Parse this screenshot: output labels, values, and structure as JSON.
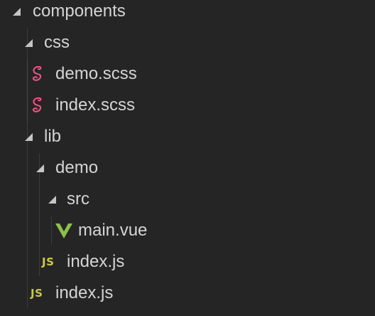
{
  "explorer": {
    "items": [
      {
        "label": "components",
        "kind": "folder",
        "expanded": true
      },
      {
        "label": "css",
        "kind": "folder",
        "expanded": true
      },
      {
        "label": "demo.scss",
        "kind": "file",
        "icon": "sass-icon"
      },
      {
        "label": "index.scss",
        "kind": "file",
        "icon": "sass-icon"
      },
      {
        "label": "lib",
        "kind": "folder",
        "expanded": true
      },
      {
        "label": "demo",
        "kind": "folder",
        "expanded": true
      },
      {
        "label": "src",
        "kind": "folder",
        "expanded": true
      },
      {
        "label": "main.vue",
        "kind": "file",
        "icon": "vue-icon"
      },
      {
        "label": "index.js",
        "kind": "file",
        "icon": "js-icon",
        "icon_text": "JS"
      },
      {
        "label": "index.js",
        "kind": "file",
        "icon": "js-icon",
        "icon_text": "JS"
      }
    ]
  },
  "colors": {
    "background": "#252526",
    "text": "#d4d4d4",
    "sass": "#f55385",
    "vue": "#8dc149",
    "js": "#cbcb41",
    "guide": "#3c3c3c"
  }
}
